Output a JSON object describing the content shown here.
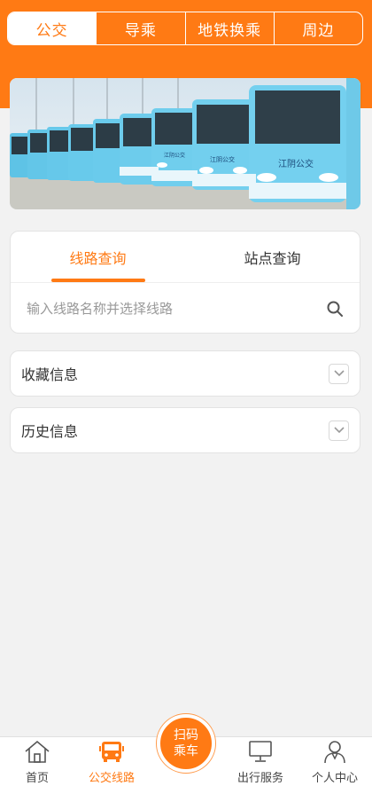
{
  "header": {
    "segments": [
      {
        "label": "公交",
        "active": true
      },
      {
        "label": "导乘",
        "active": false
      },
      {
        "label": "地铁换乘",
        "active": false
      },
      {
        "label": "周边",
        "active": false
      }
    ]
  },
  "banner": {
    "bus_text_1": "江阴公交",
    "bus_text_2": "江阴公交",
    "bus_text_3": "江阴公交"
  },
  "query": {
    "tabs": [
      {
        "label": "线路查询",
        "active": true
      },
      {
        "label": "站点查询",
        "active": false
      }
    ],
    "search_placeholder": "输入线路名称并选择线路",
    "search_value": ""
  },
  "favorites": {
    "label": "收藏信息"
  },
  "history": {
    "label": "历史信息"
  },
  "bottom_nav": {
    "items": [
      {
        "label": "首页",
        "icon": "home-icon"
      },
      {
        "label": "公交线路",
        "icon": "bus-icon",
        "active": true
      },
      {
        "label": "",
        "icon": "scan-icon"
      },
      {
        "label": "出行服务",
        "icon": "monitor-icon"
      },
      {
        "label": "个人中心",
        "icon": "person-icon"
      }
    ],
    "scan_line1": "扫码",
    "scan_line2": "乘车"
  },
  "colors": {
    "accent": "#ff7a14",
    "background": "#f2f2f2"
  }
}
